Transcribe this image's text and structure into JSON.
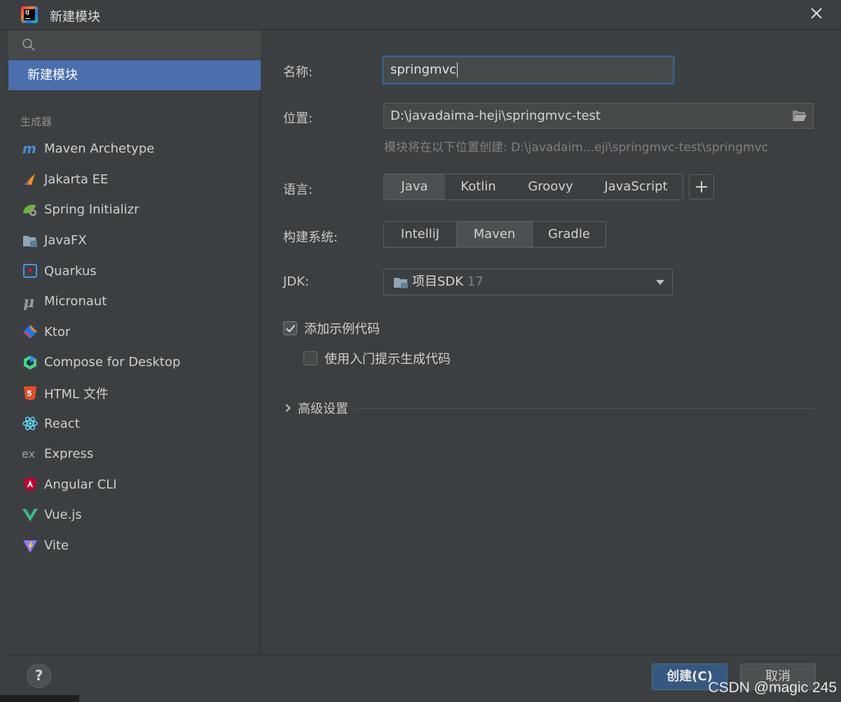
{
  "window": {
    "title": "新建模块",
    "close_icon": "close-icon"
  },
  "sidebar": {
    "search_placeholder": "",
    "selected_item": "新建模块",
    "group_label": "生成器",
    "generators": [
      {
        "label": "Maven Archetype",
        "icon": "maven-icon"
      },
      {
        "label": "Jakarta EE",
        "icon": "jakarta-ee-icon"
      },
      {
        "label": "Spring Initializr",
        "icon": "spring-icon"
      },
      {
        "label": "JavaFX",
        "icon": "javafx-icon"
      },
      {
        "label": "Quarkus",
        "icon": "quarkus-icon"
      },
      {
        "label": "Micronaut",
        "icon": "micronaut-icon"
      },
      {
        "label": "Ktor",
        "icon": "ktor-icon"
      },
      {
        "label": "Compose for Desktop",
        "icon": "compose-icon"
      },
      {
        "label": "HTML 文件",
        "icon": "html5-icon"
      },
      {
        "label": "React",
        "icon": "react-icon"
      },
      {
        "label": "Express",
        "icon": "express-icon"
      },
      {
        "label": "Angular CLI",
        "icon": "angular-icon"
      },
      {
        "label": "Vue.js",
        "icon": "vue-icon"
      },
      {
        "label": "Vite",
        "icon": "vite-icon"
      }
    ]
  },
  "form": {
    "name_label": "名称:",
    "name_value": "springmvc",
    "location_label": "位置:",
    "location_value": "D:\\javadaima-heji\\springmvc-test",
    "location_hint": "模块将在以下位置创建: D:\\javadaim...eji\\springmvc-test\\springmvc",
    "language_label": "语言:",
    "languages": [
      "Java",
      "Kotlin",
      "Groovy",
      "JavaScript"
    ],
    "language_selected": "Java",
    "build_label": "构建系统:",
    "build_systems": [
      "IntelliJ",
      "Maven",
      "Gradle"
    ],
    "build_selected": "Maven",
    "jdk_label": "JDK:",
    "jdk_name": "项目SDK",
    "jdk_version": "17",
    "sample_code_label": "添加示例代码",
    "sample_code_checked": true,
    "onboarding_label": "使用入门提示生成代码",
    "onboarding_checked": false,
    "advanced_label": "高级设置"
  },
  "footer": {
    "help_label": "?",
    "create_label": "创建(C)",
    "cancel_label": "取消"
  },
  "watermark": "CSDN @magic 245",
  "colors": {
    "selection": "#4b6eaf",
    "background": "#3c3f41",
    "primary_button": "#365880"
  }
}
